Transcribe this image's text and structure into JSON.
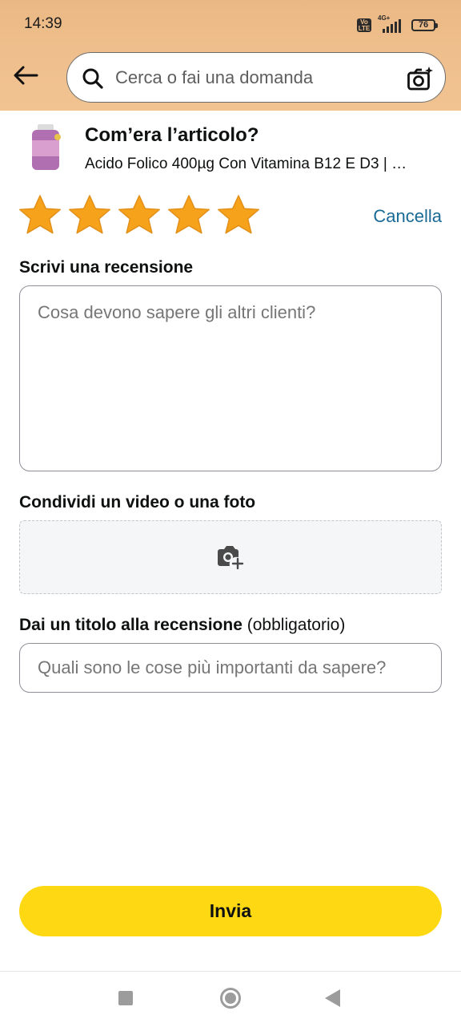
{
  "status_bar": {
    "time": "14:39",
    "volte": "Vo LTE",
    "network": "4G+",
    "battery": "76"
  },
  "search": {
    "placeholder": "Cerca o fai una domanda"
  },
  "review": {
    "heading": "Com’era l’articolo?",
    "product_name": "Acido Folico 400µg Con Vitamina B12 E D3 | …",
    "rating": 5,
    "rating_max": 5,
    "star_color": "#f7a21b",
    "clear_label": "Cancella",
    "write_label": "Scrivi una recensione",
    "write_placeholder": "Cosa devono sapere gli altri clienti?",
    "media_label": "Condividi un video o una foto",
    "title_label": "Dai un titolo alla recensione",
    "title_required": "(obbligatorio)",
    "title_placeholder": "Quali sono le cose più importanti da sapere?",
    "submit_label": "Invia"
  },
  "colors": {
    "header_bg": "#efc08e",
    "link": "#1a6a96",
    "submit_bg": "#ffd814"
  },
  "icons": [
    "back-arrow-icon",
    "search-icon",
    "camera-search-icon",
    "add-photo-icon",
    "star-icon"
  ]
}
